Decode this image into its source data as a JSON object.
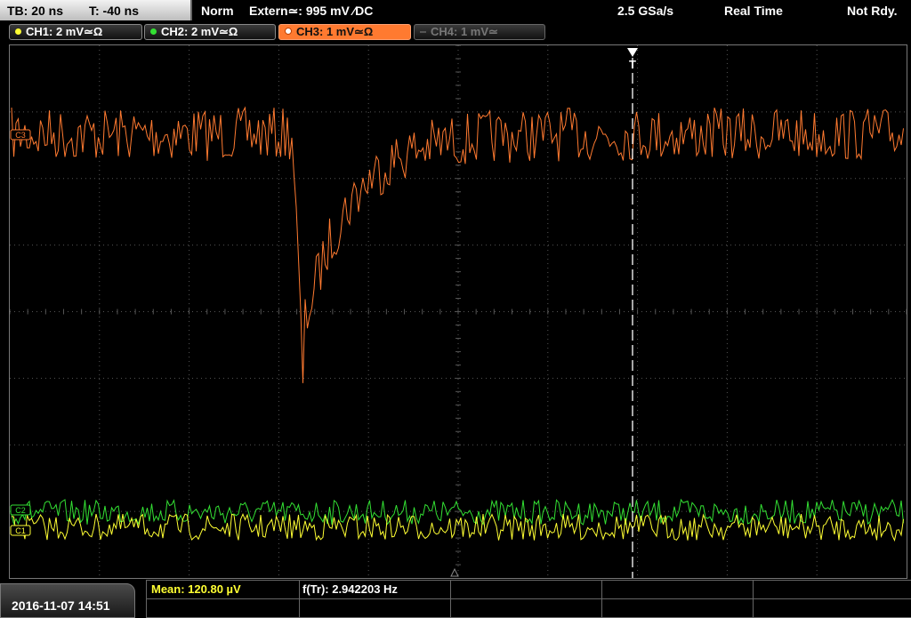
{
  "top": {
    "timebase": "TB: 20 ns",
    "trigger_time": "T: -40 ns",
    "trigger_mode": "Norm",
    "trigger_source": "Extern≃: 995 mV ∕DC",
    "sample_rate": "2.5 GSa/s",
    "acq_mode": "Real Time",
    "status": "Not Rdy."
  },
  "channels": [
    {
      "label": "CH1: 2 mV≃Ω",
      "color": "#ffff33",
      "state": "on"
    },
    {
      "label": "CH2: 2 mV≃Ω",
      "color": "#33e033",
      "state": "on"
    },
    {
      "label": "CH3: 1 mV≃Ω",
      "color": "#ff7a30",
      "state": "active"
    },
    {
      "label": "CH4: 1 mV≃",
      "color": "#777777",
      "state": "off"
    }
  ],
  "markers": {
    "ch3": "C3",
    "ch2": "C2",
    "ch1": "C1",
    "trigger": "T"
  },
  "bottom": {
    "datetime": "2016-11-07 14:51",
    "measure1": "Mean: 120.80 µV",
    "measure2": "f(Tr): 2.942203 Hz"
  },
  "colors": {
    "ch1": "#ffff33",
    "ch2": "#33e033",
    "ch3": "#ff7a30",
    "grid": "#555555"
  }
}
